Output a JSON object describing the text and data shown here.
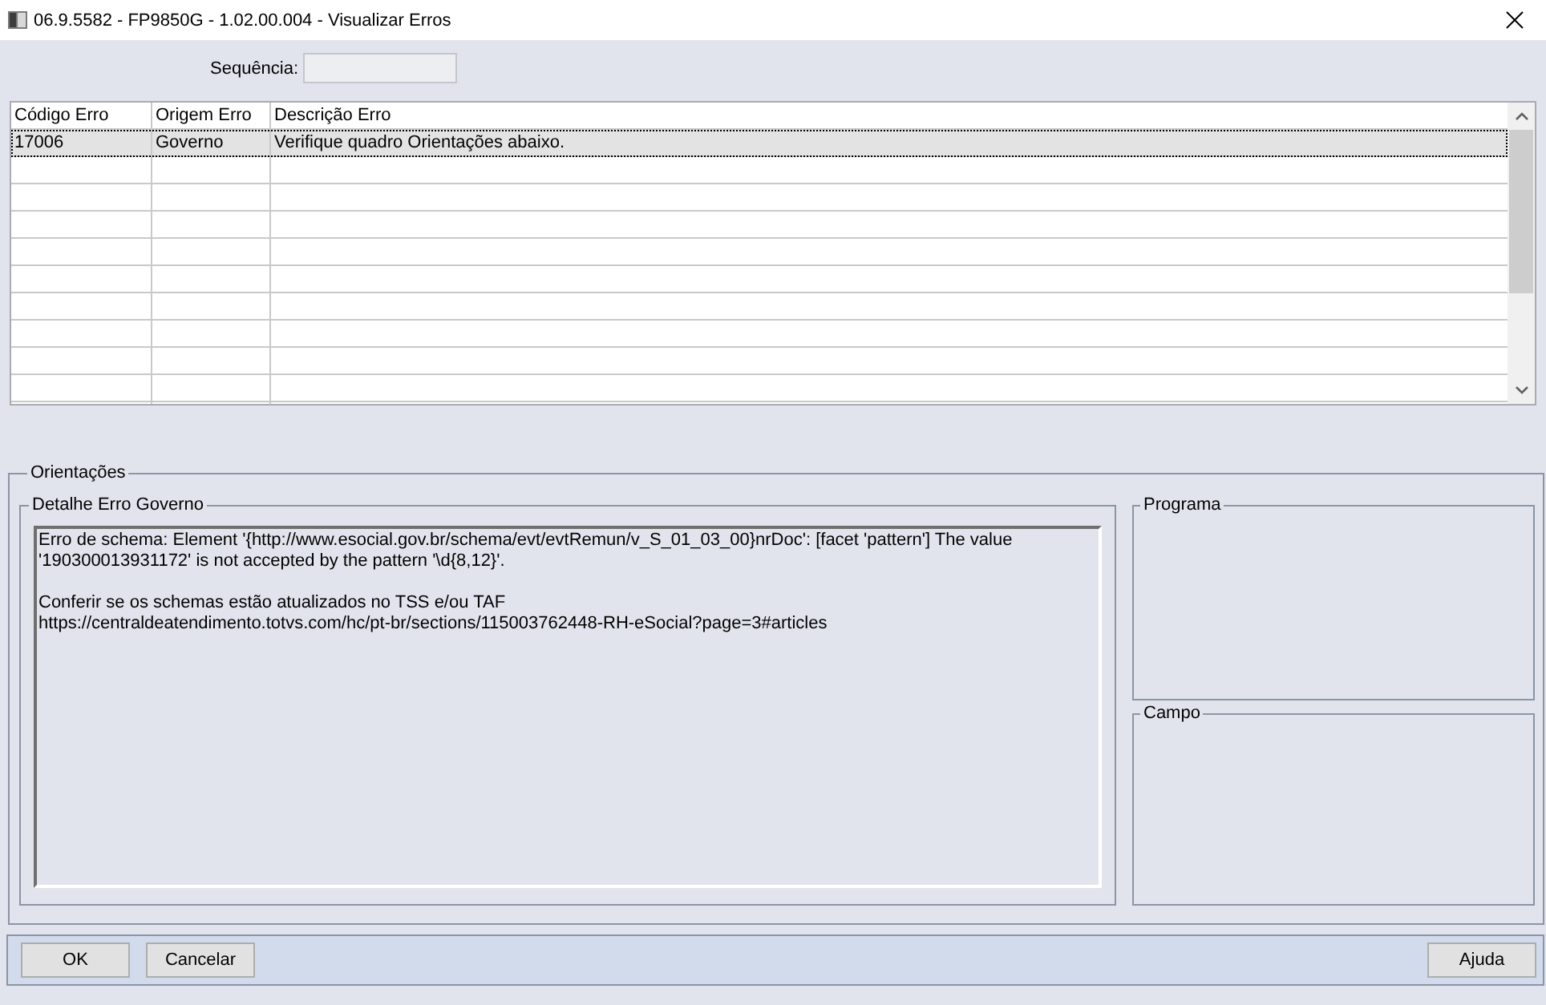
{
  "window": {
    "title": "06.9.5582 - FP9850G - 1.02.00.004 - Visualizar Erros"
  },
  "sequence": {
    "label": "Sequência:",
    "disabled": true
  },
  "table": {
    "columns": [
      "Código Erro",
      "Origem Erro",
      "Descrição Erro"
    ],
    "rows": [
      {
        "cells": [
          "17006",
          "Governo",
          "Verifique quadro Orientações abaixo."
        ],
        "selected": true
      }
    ]
  },
  "orientations": {
    "label": "Orientações",
    "detail": {
      "label": "Detalhe Erro Governo",
      "paragraphs": [
        {
          "lines": [
            "Erro de schema: Element '{http://www.esocial.gov.br/schema/evt/evtRemun/v_S_01_03_00}nrDoc': [facet 'pattern'] The value",
            "'190300013931172' is not accepted by the pattern '\\d{8,12}'."
          ]
        },
        {
          "lines": [
            "Conferir se os schemas estão atualizados no TSS e/ou TAF",
            "https://centraldeatendimento.totvs.com/hc/pt-br/sections/115003762448-RH-eSocial?page=3#articles"
          ]
        }
      ]
    },
    "program": {
      "label": "Programa"
    },
    "field": {
      "label": "Campo"
    }
  },
  "buttons": {
    "left": [
      "OK",
      "Cancelar"
    ],
    "right": [
      "Ajuda"
    ]
  }
}
